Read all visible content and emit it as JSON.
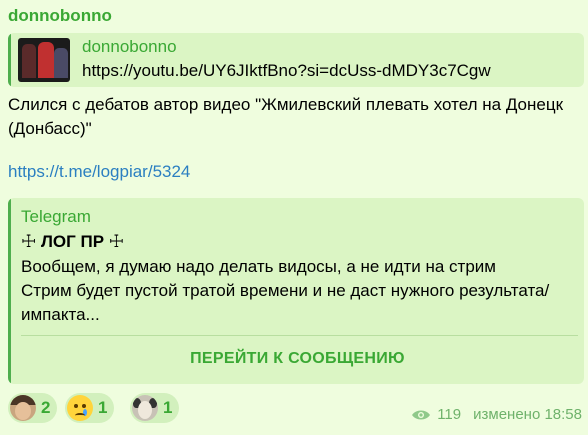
{
  "author": "donnobonno",
  "reply": {
    "name": "donnobonno",
    "text": "https://youtu.be/UY6JIktfBno?si=dcUss-dMDY3c7Cgw"
  },
  "message": {
    "text": "Слился с дебатов автор видео \"Жмилевский плевать хотел на Донецк (Донбасс)\"",
    "link": "https://t.me/logpiar/5324"
  },
  "forwarded": {
    "source": "Telegram",
    "channel": "☩ ЛОГ ПР ☩",
    "body": "Вообщем, я думаю надо делать видосы, а не идти на стрим\nСтрим будет пустой тратой времени и не даст нужного результата/импакта...",
    "button": "ПЕРЕЙТИ К СООБЩЕНИЮ"
  },
  "reactions": [
    {
      "avatar": "user-avatar-icon",
      "count": "2"
    },
    {
      "avatar": "crying-face-icon",
      "count": "1"
    },
    {
      "avatar": "cat-avatar-icon",
      "count": "1"
    }
  ],
  "meta": {
    "views": "119",
    "edited": "изменено 18:58"
  },
  "colors": {
    "background": "#effdde",
    "accent": "#3aa834",
    "link": "#2b7fc1",
    "quote": "#dbf5c4"
  }
}
